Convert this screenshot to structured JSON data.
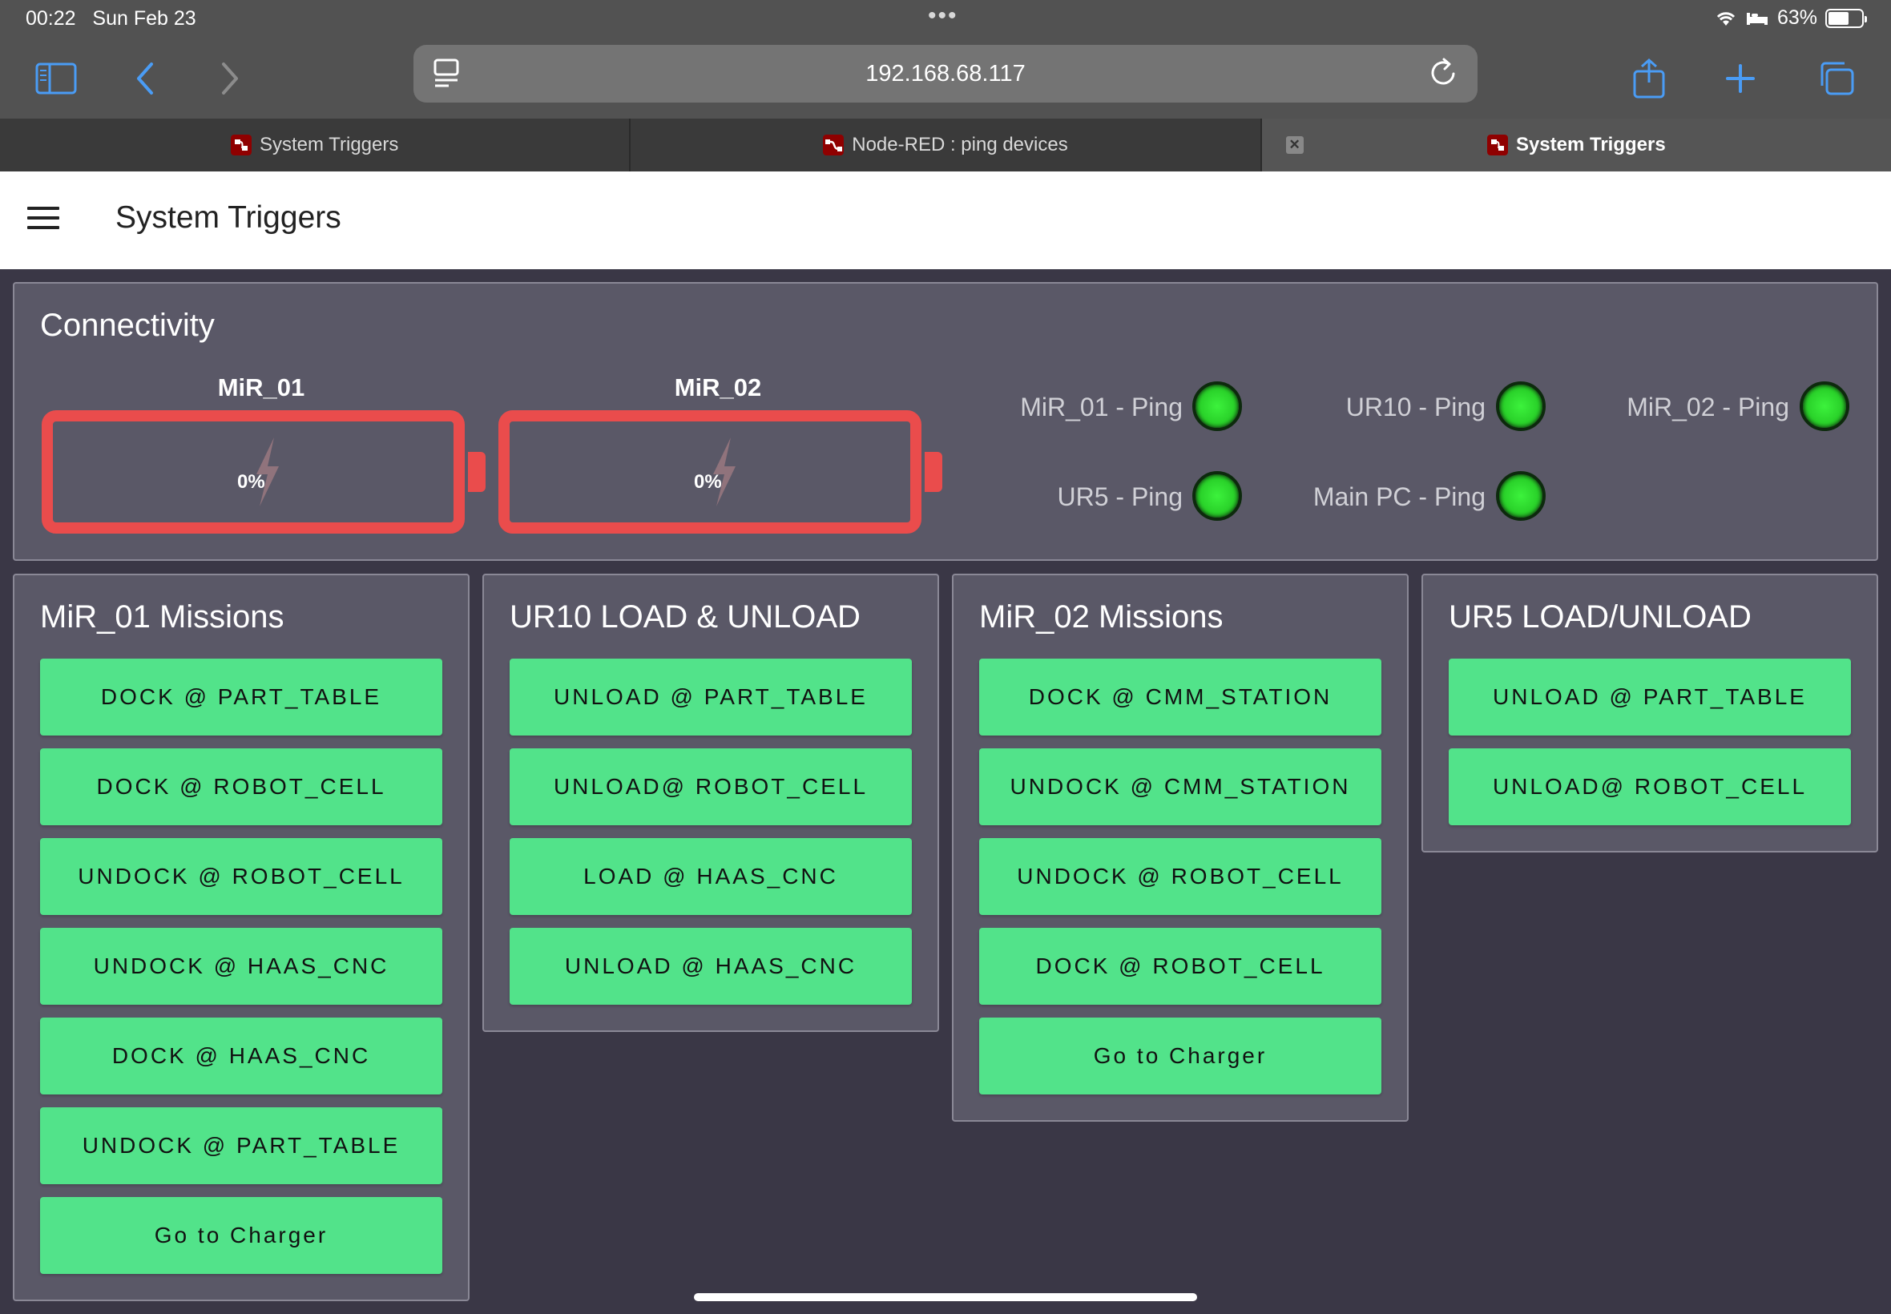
{
  "status": {
    "time": "00:22",
    "date": "Sun Feb 23",
    "battery": "63%",
    "battery_level": 0.63
  },
  "browser": {
    "url": "192.168.68.117"
  },
  "tabs": [
    {
      "label": "System Triggers"
    },
    {
      "label": "Node-RED : ping devices"
    },
    {
      "label": "System Triggers"
    }
  ],
  "app": {
    "title": "System Triggers"
  },
  "connectivity": {
    "title": "Connectivity",
    "batteries": [
      {
        "label": "MiR_01",
        "value": "0%"
      },
      {
        "label": "MiR_02",
        "value": "0%"
      }
    ],
    "pings": [
      {
        "label": "MiR_01 - Ping",
        "status": "green"
      },
      {
        "label": "UR10 - Ping",
        "status": "green"
      },
      {
        "label": "MiR_02 - Ping",
        "status": "green"
      },
      {
        "label": "UR5 - Ping",
        "status": "green"
      },
      {
        "label": "Main PC - Ping",
        "status": "green"
      }
    ]
  },
  "groups": [
    {
      "title": "MiR_01 Missions",
      "buttons": [
        "DOCK @ PART_TABLE",
        "DOCK @ ROBOT_CELL",
        "UNDOCK @ ROBOT_CELL",
        "UNDOCK @ HAAS_CNC",
        "DOCK @ HAAS_CNC",
        "UNDOCK @ PART_TABLE",
        "Go to Charger"
      ]
    },
    {
      "title": "UR10 LOAD & UNLOAD",
      "buttons": [
        "UNLOAD @ PART_TABLE",
        "UNLOAD@ ROBOT_CELL",
        "LOAD @ HAAS_CNC",
        "UNLOAD @ HAAS_CNC"
      ]
    },
    {
      "title": "MiR_02 Missions",
      "buttons": [
        "DOCK @ CMM_STATION",
        "UNDOCK @ CMM_STATION",
        "UNDOCK @ ROBOT_CELL",
        "DOCK @ ROBOT_CELL",
        "Go to Charger"
      ]
    },
    {
      "title": "UR5 LOAD/UNLOAD",
      "buttons": [
        "UNLOAD @ PART_TABLE",
        "UNLOAD@ ROBOT_CELL"
      ]
    }
  ],
  "colors": {
    "button": "#52e38a",
    "battery_border": "#ea4c4c",
    "led": "#2ad22a",
    "card": "#5a5867",
    "page_bg": "#3a3746"
  }
}
